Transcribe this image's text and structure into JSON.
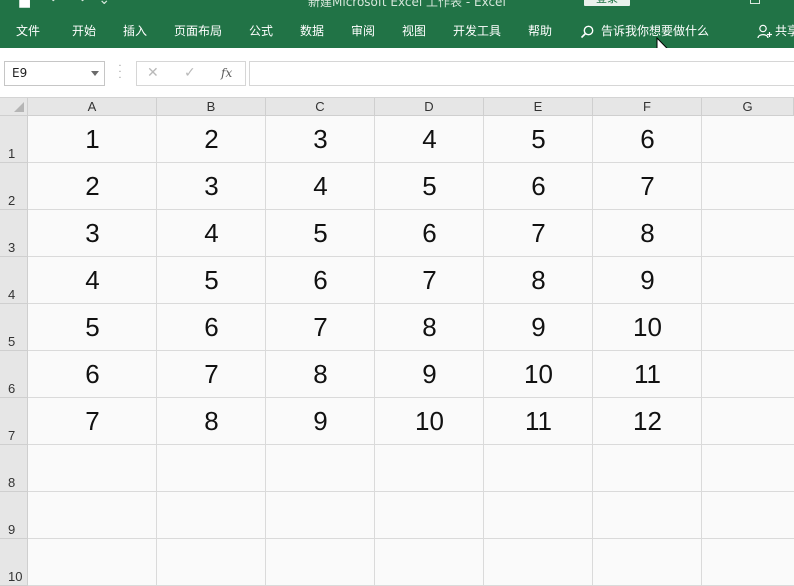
{
  "titlebar": {
    "title": "新建Microsoft Excel 工作表 - Excel",
    "login_label": "登录"
  },
  "ribbon": {
    "tabs": [
      "文件",
      "开始",
      "插入",
      "页面布局",
      "公式",
      "数据",
      "审阅",
      "视图",
      "开发工具",
      "帮助"
    ],
    "tell_me": "告诉我你想要做什么",
    "share": "共享"
  },
  "formula_bar": {
    "name_box": "E9",
    "cancel_glyph": "✕",
    "enter_glyph": "✓",
    "fx_label": "fx",
    "formula_value": ""
  },
  "sheet": {
    "columns": [
      "A",
      "B",
      "C",
      "D",
      "E",
      "F",
      "G"
    ],
    "rows": [
      "1",
      "2",
      "3",
      "4",
      "5",
      "6",
      "7",
      "8",
      "9",
      "10"
    ],
    "cells": [
      [
        "1",
        "2",
        "3",
        "4",
        "5",
        "6"
      ],
      [
        "2",
        "3",
        "4",
        "5",
        "6",
        "7"
      ],
      [
        "3",
        "4",
        "5",
        "6",
        "7",
        "8"
      ],
      [
        "4",
        "5",
        "6",
        "7",
        "8",
        "9"
      ],
      [
        "5",
        "6",
        "7",
        "8",
        "9",
        "10"
      ],
      [
        "6",
        "7",
        "8",
        "9",
        "10",
        "11"
      ],
      [
        "7",
        "8",
        "9",
        "10",
        "11",
        "12"
      ]
    ]
  },
  "colors": {
    "ribbon": "#217346",
    "header_bg": "#e6e6e6",
    "grid_line": "#dadada"
  }
}
